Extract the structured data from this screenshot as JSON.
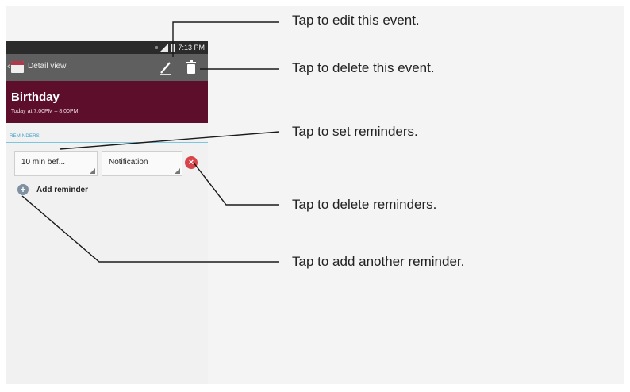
{
  "statusbar": {
    "time": "7:13 PM"
  },
  "actionbar": {
    "back_glyph": "‹",
    "title": "Detail view",
    "edit_icon": "pencil-icon",
    "delete_icon": "trash-icon"
  },
  "event": {
    "title": "Birthday",
    "time": "Today at 7:00PM – 8:00PM"
  },
  "reminders": {
    "section_label": "REMINDERS",
    "time_value": "10 min bef...",
    "type_value": "Notification",
    "delete_icon": "remove-icon",
    "add_label": "Add reminder",
    "add_icon": "plus-icon"
  },
  "callouts": {
    "edit": "Tap to edit this event.",
    "delete_event": "Tap to delete this event.",
    "set_reminders": "Tap to set reminders.",
    "delete_reminders": "Tap to delete reminders.",
    "add_reminder": "Tap to add another reminder."
  },
  "colors": {
    "event_header": "#5c0e2a",
    "action_bar": "#5f5f5f",
    "status_bar": "#2b2b2b",
    "accent_blue": "#3fa0c8",
    "delete_red": "#d9434a"
  }
}
